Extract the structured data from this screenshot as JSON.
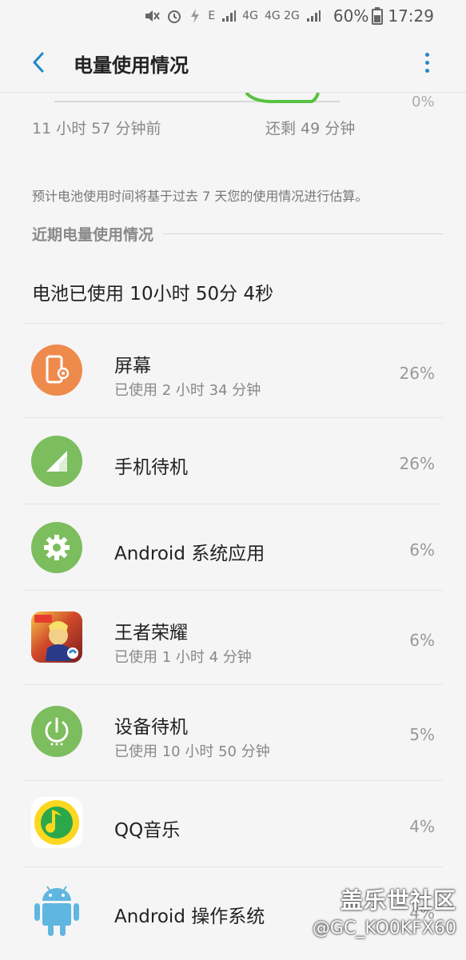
{
  "status_bar": {
    "network_small": "E",
    "net1": "4G",
    "net2": "4G 2G",
    "battery": "60%",
    "time": "17:29"
  },
  "app_bar": {
    "title": "电量使用情况"
  },
  "graph": {
    "left_label": "11 小时 57 分钟前",
    "right_label": "还剩 49 分钟",
    "pct_label": "0%"
  },
  "note": "预计电池使用时间将基于过去 7 天您的使用情况进行估算。",
  "section": {
    "title": "近期电量使用情况"
  },
  "battery_used": "电池已使用 10小时 50分 4秒",
  "items": [
    {
      "name": "屏幕",
      "sub": "已使用 2 小时 34 分钟",
      "pct": "26%",
      "icon": "screen-icon",
      "color": "#ee8a4c"
    },
    {
      "name": "手机待机",
      "sub": "",
      "pct": "26%",
      "icon": "signal-icon",
      "color": "#7cbd5e"
    },
    {
      "name": "Android 系统应用",
      "sub": "",
      "pct": "6%",
      "icon": "gear-icon",
      "color": "#7cbd5e"
    },
    {
      "name": "王者荣耀",
      "sub": "已使用 1 小时 4 分钟",
      "pct": "6%",
      "icon": "game-icon",
      "color": "#b23a2a"
    },
    {
      "name": "设备待机",
      "sub": "已使用 10 小时 50 分钟",
      "pct": "5%",
      "icon": "power-icon",
      "color": "#7cbd5e"
    },
    {
      "name": "QQ音乐",
      "sub": "",
      "pct": "4%",
      "icon": "qq-music-icon",
      "color": "#fbd81f"
    },
    {
      "name": "Android 操作系统",
      "sub": "",
      "pct": "4%",
      "icon": "android-icon",
      "color": "#5fb6e0"
    }
  ],
  "watermark": {
    "line1": "盖乐世社区",
    "line2": "@GC_KO0KFX60"
  }
}
